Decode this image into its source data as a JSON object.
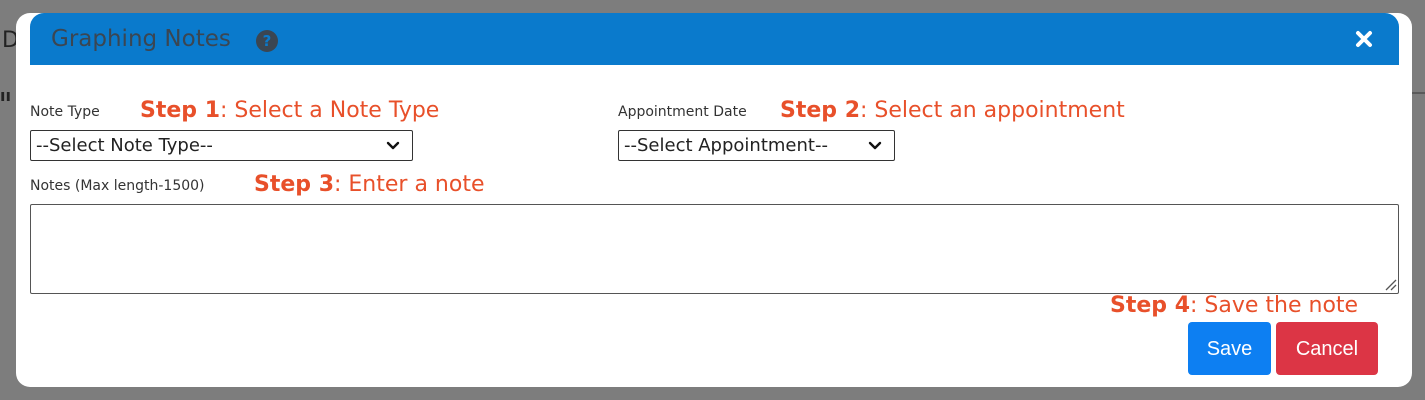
{
  "background": {
    "partial_letter": "D",
    "partial_mark": "ıı"
  },
  "modal": {
    "title": "Graphing Notes",
    "help_icon": "question-circle-icon",
    "close_icon": "close-icon",
    "header_color": "#0a7acc"
  },
  "form": {
    "note_type": {
      "label": "Note Type",
      "step_bold": "Step 1",
      "step_text": ": Select a Note Type",
      "selected": "--Select Note Type--"
    },
    "appointment_date": {
      "label": "Appointment Date",
      "step_bold": "Step 2",
      "step_text": ": Select an appointment",
      "selected": "--Select Appointment--"
    },
    "notes": {
      "label": "Notes (Max length-1500)",
      "step_bold": "Step 3",
      "step_text": ": Enter a note",
      "value": ""
    },
    "save_step": {
      "step_bold": "Step 4",
      "step_text": ": Save the note"
    }
  },
  "buttons": {
    "save_label": "Save",
    "cancel_label": "Cancel",
    "save_color": "#0d7ff2",
    "cancel_color": "#dc3545"
  },
  "step_color": "#e8502a"
}
